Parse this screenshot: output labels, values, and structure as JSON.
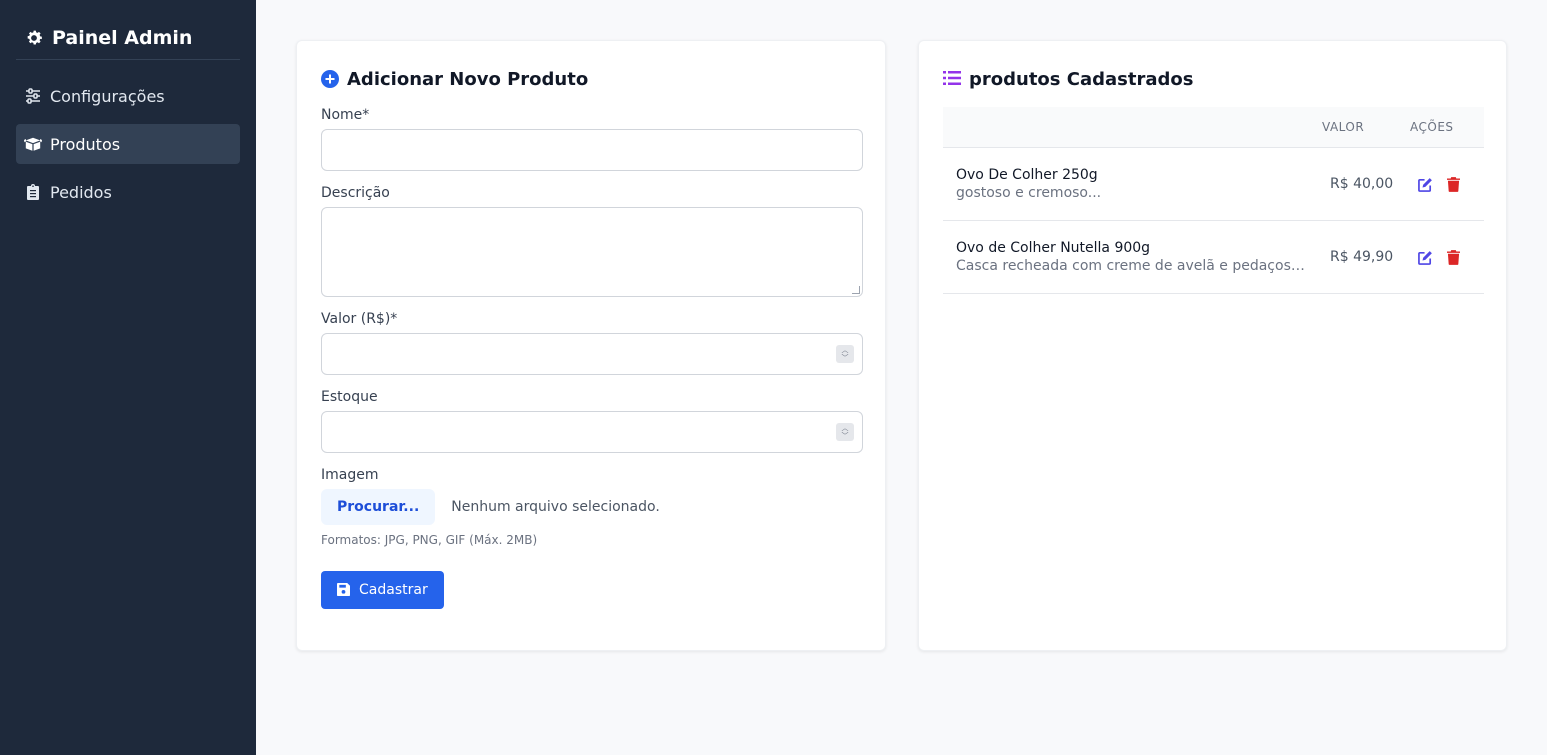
{
  "sidebar": {
    "title": "Painel Admin",
    "items": [
      {
        "label": "Configurações",
        "icon": "sliders-icon"
      },
      {
        "label": "Produtos",
        "icon": "box-open-icon",
        "active": true
      },
      {
        "label": "Pedidos",
        "icon": "clipboard-icon"
      }
    ]
  },
  "form": {
    "title": "Adicionar Novo Produto",
    "name_label": "Nome*",
    "name_value": "",
    "desc_label": "Descrição",
    "desc_value": "",
    "price_label": "Valor (R$)*",
    "price_value": "",
    "stock_label": "Estoque",
    "stock_value": "",
    "image_label": "Imagem",
    "browse_label": "Procurar...",
    "file_status": "Nenhum arquivo selecionado.",
    "formats_hint": "Formatos: JPG, PNG, GIF (Máx. 2MB)",
    "submit_label": "Cadastrar"
  },
  "list": {
    "title": "produtos Cadastrados",
    "columns": {
      "name": "",
      "value": "VALOR",
      "actions": "AÇÕES"
    },
    "rows": [
      {
        "name": "Ovo De Colher 250g",
        "desc": "gostoso e cremoso...",
        "value": "R$ 40,00"
      },
      {
        "name": "Ovo de Colher Nutella 900g",
        "desc": "Casca recheada com creme de avelã e pedaços de b...",
        "value": "R$ 49,90"
      }
    ]
  },
  "colors": {
    "sidebar_bg": "#1e293b",
    "primary": "#2563eb",
    "list_icon": "#9333ea",
    "edit_icon": "#4f46e5",
    "delete_icon": "#dc2626"
  }
}
